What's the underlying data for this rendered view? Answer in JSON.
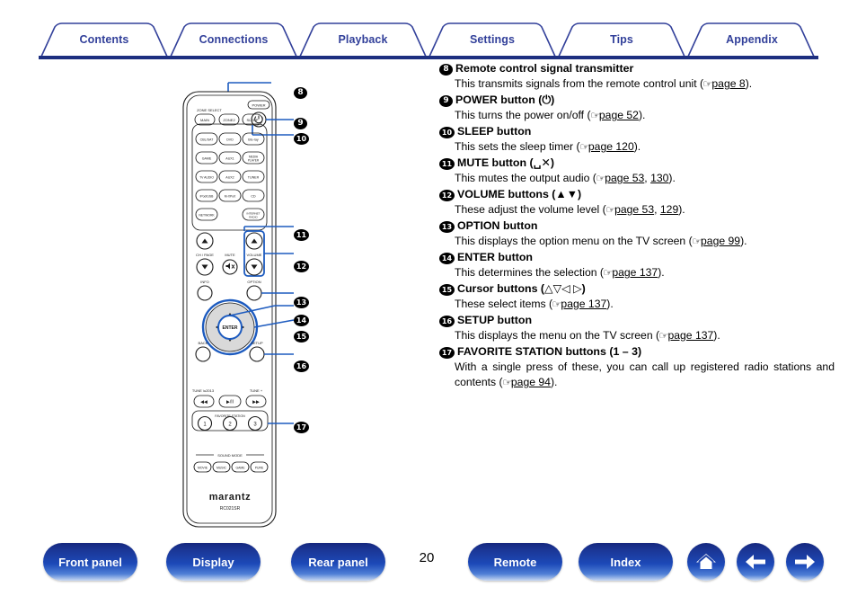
{
  "tabs": [
    {
      "label": "Contents",
      "active": false
    },
    {
      "label": "Connections",
      "active": false
    },
    {
      "label": "Playback",
      "active": false
    },
    {
      "label": "Settings",
      "active": true
    },
    {
      "label": "Tips",
      "active": false
    },
    {
      "label": "Appendix",
      "active": false
    }
  ],
  "entries": [
    {
      "num": "8",
      "title": "Remote control signal transmitter",
      "body_pre": "This transmits signals from the remote control unit (",
      "pages": [
        "page 8"
      ],
      "body_post": ")."
    },
    {
      "num": "9",
      "title": "POWER button (⏻)",
      "body_pre": "This turns the power on/off (",
      "pages": [
        "page 52"
      ],
      "body_post": ")."
    },
    {
      "num": "10",
      "title": "SLEEP button",
      "body_pre": "This sets the sleep timer (",
      "pages": [
        "page 120"
      ],
      "body_post": ")."
    },
    {
      "num": "11",
      "title": "MUTE button (␣✕)",
      "body_pre": "This mutes the output audio (",
      "pages": [
        "page 53",
        "130"
      ],
      "body_post": ")."
    },
    {
      "num": "12",
      "title": "VOLUME buttons (▲▼)",
      "body_pre": "These adjust the volume level (",
      "pages": [
        "page 53",
        "129"
      ],
      "body_post": ")."
    },
    {
      "num": "13",
      "title": "OPTION button",
      "body_pre": "This displays the option menu on the TV screen (",
      "pages": [
        "page 99"
      ],
      "body_post": ")."
    },
    {
      "num": "14",
      "title": "ENTER button",
      "body_pre": "This determines the selection (",
      "pages": [
        "page 137"
      ],
      "body_post": ")."
    },
    {
      "num": "15",
      "title": "Cursor buttons (△▽◁ ▷)",
      "body_pre": "These select items (",
      "pages": [
        "page 137"
      ],
      "body_post": ")."
    },
    {
      "num": "16",
      "title": "SETUP button",
      "body_pre": "This displays the menu on the TV screen (",
      "pages": [
        "page 137"
      ],
      "body_post": ")."
    },
    {
      "num": "17",
      "title": "FAVORITE STATION buttons (1 – 3)",
      "body_pre": "With a single press of these, you can call up registered radio stations and contents (",
      "pages": [
        "page 94"
      ],
      "body_post": ")."
    }
  ],
  "callouts": [
    "8",
    "9",
    "10",
    "11",
    "12",
    "13",
    "14",
    "15",
    "16",
    "17"
  ],
  "remote": {
    "brand": "marantz",
    "model": "RC021SR",
    "zone_select_label": "ZONE SELECT",
    "zone_buttons": [
      "MAIN",
      "ZONE2"
    ],
    "sleep_button": "SLEEP",
    "power_label": "POWER",
    "power_glyph": "⏻",
    "source_buttons": [
      "CBL/SAT",
      "DVD",
      "Blu-ray",
      "GAME",
      "AUX1",
      "MEDIA PLAYER",
      "TV AUDIO",
      "AUX2",
      "TUNER",
      "iPod/USB",
      "M-XPort",
      "CD",
      "NETWORK",
      "INTERNET RADIO"
    ],
    "ch_page_label": "CH / PAGE",
    "mute_label": "MUTE",
    "volume_label": "VOLUME",
    "info_label": "INFO",
    "option_label": "OPTION",
    "enter_label": "ENTER",
    "back_label": "BACK",
    "setup_label": "SETUP",
    "tune_minus_label": "TUNE –",
    "tune_plus_label": "TUNE +",
    "play_pause_glyph": "▶/II",
    "prev_glyph": "◀◀",
    "next_glyph": "▶▶",
    "favorite_label": "FAVORITE STATION",
    "favorite_buttons": [
      "1",
      "2",
      "3"
    ],
    "sound_mode_label": "SOUND MODE",
    "sound_mode_buttons": [
      "MOVIE",
      "MUSIC",
      "GAME",
      "PURE"
    ]
  },
  "bottom": {
    "page_number": "20",
    "buttons": [
      {
        "label": "Front panel"
      },
      {
        "label": "Display"
      },
      {
        "label": "Rear panel"
      },
      {
        "label": "Remote"
      },
      {
        "label": "Index"
      }
    ],
    "icons": [
      {
        "name": "home-icon"
      },
      {
        "name": "back-arrow-icon"
      },
      {
        "name": "forward-arrow-icon"
      }
    ]
  },
  "colors": {
    "tab_text": "#32409a",
    "rule": "#1d2f80",
    "button_blue": "#1c49b8",
    "callout_line": "#1d5bbf"
  }
}
